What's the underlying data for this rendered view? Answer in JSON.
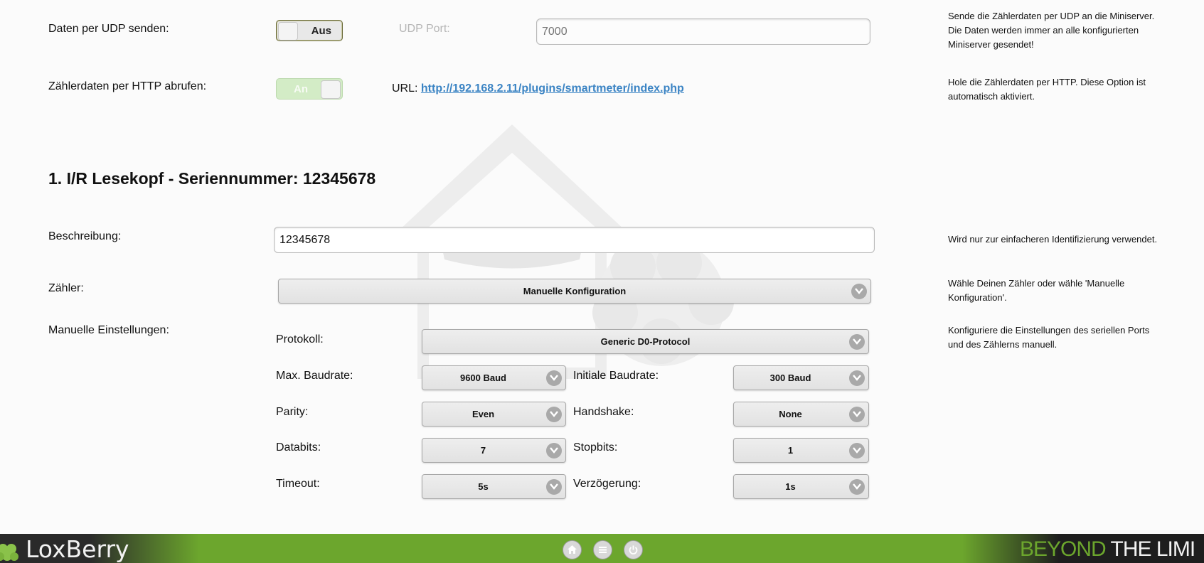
{
  "udp": {
    "label": "Daten per UDP senden:",
    "toggle_state": "Aus",
    "port_label": "UDP Port:",
    "port_placeholder": "7000",
    "help": "Sende die Zählerdaten per UDP an die Miniserver. Die Daten werden immer an alle konfigurierten Miniserver gesendet!"
  },
  "http": {
    "label": "Zählerdaten per HTTP abrufen:",
    "toggle_state": "An",
    "url_label": "URL:",
    "url": "http://192.168.2.11/plugins/smartmeter/index.php",
    "help": "Hole die Zählerdaten per HTTP. Diese Option ist automatisch aktiviert."
  },
  "section_title": "1. I/R Lesekopf - Seriennummer: 12345678",
  "description": {
    "label": "Beschreibung:",
    "value": "12345678",
    "help": "Wird nur zur einfacheren Identifizierung verwendet."
  },
  "meter": {
    "label": "Zähler:",
    "selected": "Manuelle Konfiguration",
    "help": "Wähle Deinen Zähler oder wähle 'Manuelle Konfiguration'."
  },
  "manual": {
    "label": "Manuelle Einstellungen:",
    "help": "Konfiguriere die Einstellungen des seriellen Ports und des Zählerns manuell.",
    "protocol_label": "Protokoll:",
    "protocol": "Generic D0-Protocol",
    "max_baud_label": "Max. Baudrate:",
    "max_baud": "9600 Baud",
    "init_baud_label": "Initiale Baudrate:",
    "init_baud": "300 Baud",
    "parity_label": "Parity:",
    "parity": "Even",
    "handshake_label": "Handshake:",
    "handshake": "None",
    "databits_label": "Databits:",
    "databits": "7",
    "stopbits_label": "Stopbits:",
    "stopbits": "1",
    "timeout_label": "Timeout:",
    "timeout": "5s",
    "delay_label": "Verzögerung:",
    "delay": "1s"
  },
  "footer": {
    "brand": "LoxBerry",
    "slogan_a": "BEYOND",
    "slogan_b": "THE LIMI",
    "icons": [
      "home-icon",
      "menu-icon",
      "power-icon"
    ],
    "bar_color": "#6ca62d"
  }
}
